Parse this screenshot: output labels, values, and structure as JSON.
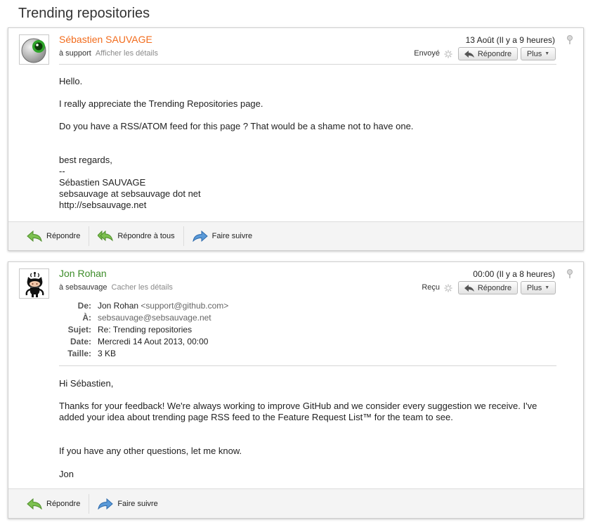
{
  "thread": {
    "title": "Trending repositories"
  },
  "messages": [
    {
      "sender": "Sébastien SAUVAGE",
      "recipient": "à support",
      "details_link": "Afficher les détails",
      "date": "13 Août (Il y a 9 heures)",
      "status": "Envoyé",
      "reply_label": "Répondre",
      "more_label": "Plus",
      "avatar_icon": "eye-ball-icon",
      "body": [
        "Hello.",
        "I really appreciate the Trending Repositories page.",
        "Do you have a RSS/ATOM feed for this page ?   That would be a shame not to have one.",
        "best regards,",
        "--",
        "Sébastien SAUVAGE",
        "sebsauvage at sebsauvage dot net",
        "http://sebsauvage.net"
      ],
      "footer": {
        "reply": "Répondre",
        "reply_all": "Répondre à tous",
        "forward": "Faire suivre"
      }
    },
    {
      "sender": "Jon Rohan",
      "recipient": "à sebsauvage",
      "details_link": "Cacher les détails",
      "date": "00:00 (Il y a 8 heures)",
      "status": "Reçu",
      "reply_label": "Répondre",
      "more_label": "Plus",
      "avatar_icon": "octocat-icon",
      "headers": {
        "from_label": "De:",
        "from_name": "Jon Rohan",
        "from_email": "<support@github.com>",
        "to_label": "À:",
        "to": "sebsauvage@sebsauvage.net",
        "subject_label": "Sujet:",
        "subject": "Re: Trending repositories",
        "date_label": "Date:",
        "date": "Mercredi 14 Aout 2013, 00:00",
        "size_label": "Taille:",
        "size": "3 KB"
      },
      "body": [
        "Hi Sébastien,",
        "Thanks for your feedback! We're always working to improve GitHub and we consider every suggestion we receive. I've added your idea about trending page RSS feed to the Feature Request List™ for the team to see.",
        "If you have any other questions, let me know.",
        "Jon"
      ],
      "footer": {
        "reply": "Répondre",
        "forward": "Faire suivre"
      }
    }
  ],
  "colors": {
    "sender1": "#f26c1d",
    "sender2": "#3e8d2a",
    "reply_arrow": "#5fa23a",
    "forward_arrow": "#3a7fc8"
  }
}
